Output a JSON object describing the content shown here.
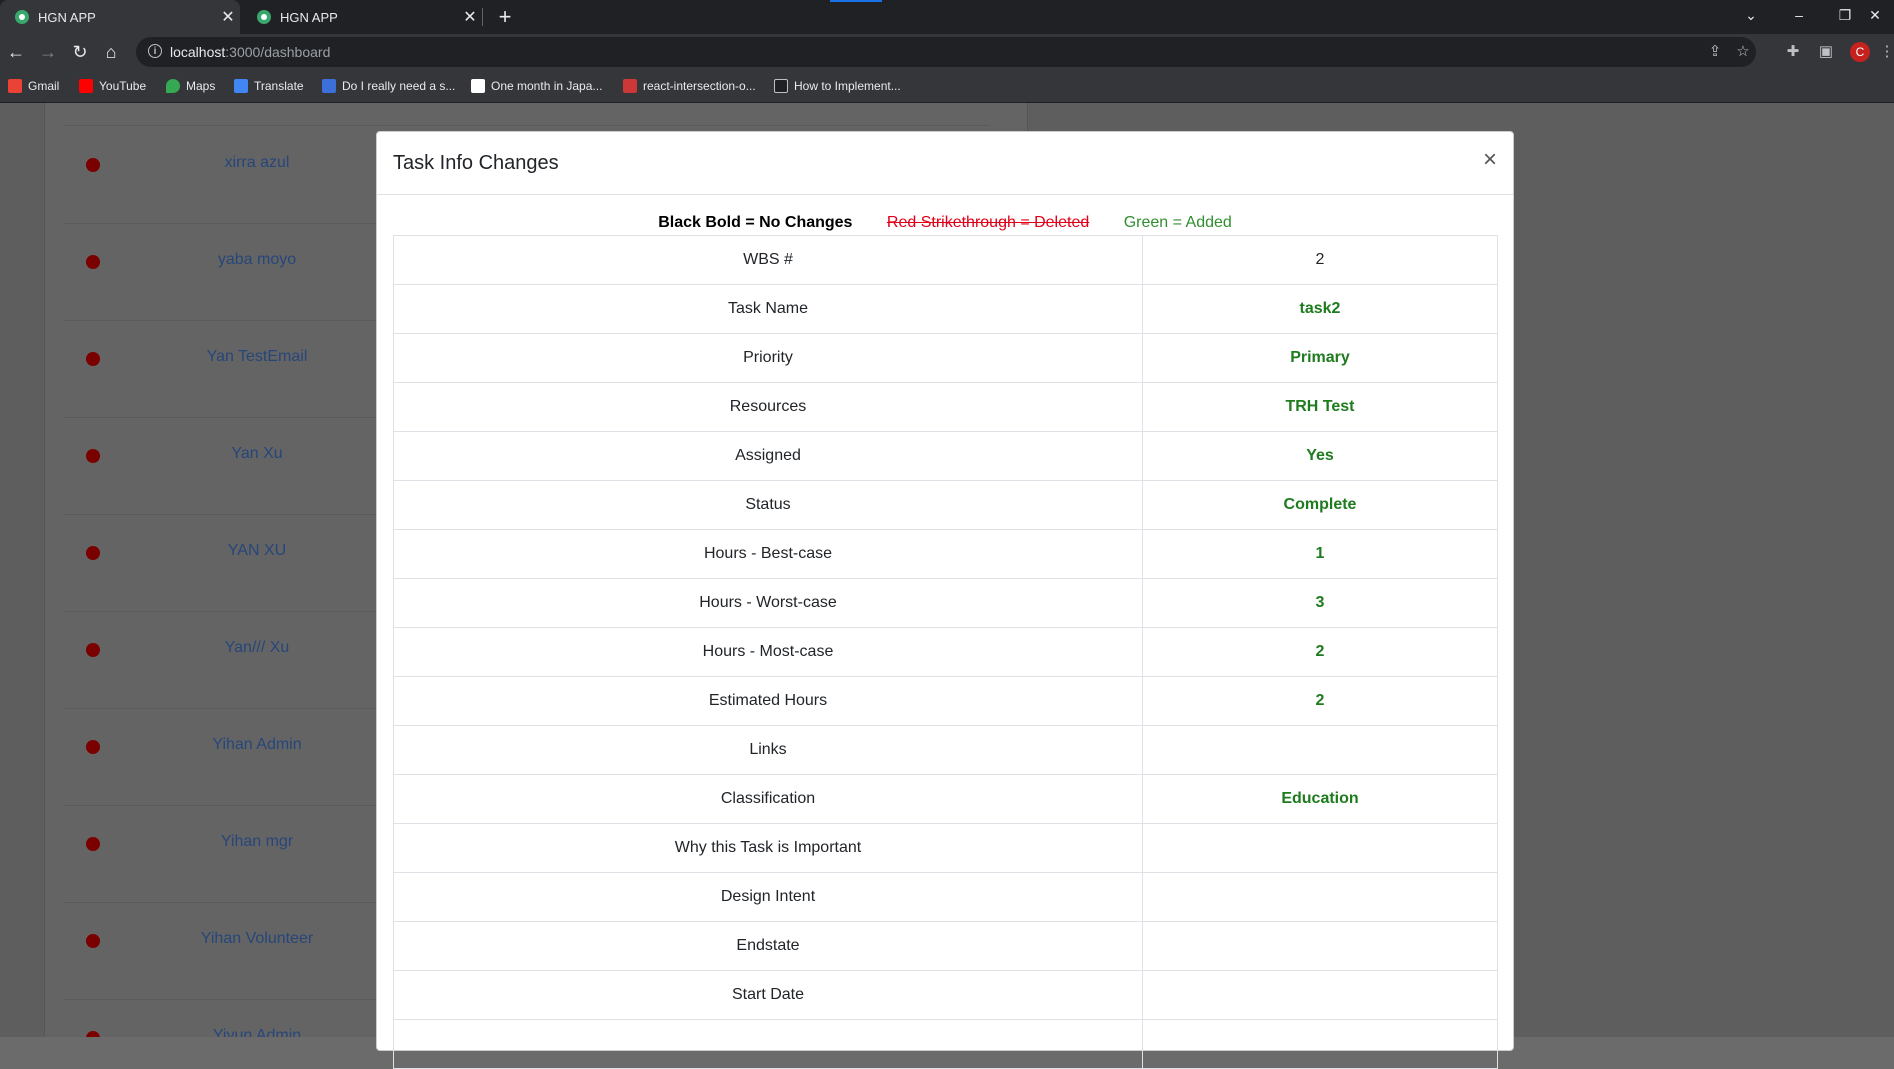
{
  "browser": {
    "tabs": [
      {
        "title": "HGN APP",
        "active": true
      },
      {
        "title": "HGN APP",
        "active": false
      }
    ],
    "url_host": "localhost",
    "url_path": ":3000/dashboard",
    "profile_initial": "C",
    "bookmarks": [
      {
        "label": "Gmail",
        "icon": "gmail-icon",
        "color": "#ea4335"
      },
      {
        "label": "YouTube",
        "icon": "youtube-icon",
        "color": "#ff0000"
      },
      {
        "label": "Maps",
        "icon": "maps-icon",
        "color": "#34a853"
      },
      {
        "label": "Translate",
        "icon": "translate-icon",
        "color": "#4285f4"
      },
      {
        "label": "Do I really need a s...",
        "icon": "site-icon",
        "color": "#3c6fd8"
      },
      {
        "label": "One month in Japa...",
        "icon": "page-icon",
        "color": "#ffffff"
      },
      {
        "label": "react-intersection-o...",
        "icon": "npm-icon",
        "color": "#cb3837"
      },
      {
        "label": "How to Implement...",
        "icon": "angular-icon",
        "color": "#202124"
      }
    ]
  },
  "background_list": {
    "users": [
      "xirra azul",
      "yaba moyo",
      "Yan TestEmail",
      "Yan Xu",
      "YAN XU",
      "Yan/// Xu",
      "Yihan Admin",
      "Yihan mgr",
      "Yihan Volunteer",
      "Yiyun Admin"
    ]
  },
  "modal": {
    "title": "Task Info Changes",
    "close_label": "×",
    "legend": {
      "no_change": "Black Bold = No Changes",
      "deleted": "Red Strikethrough = Deleted",
      "added": "Green = Added"
    },
    "rows": [
      {
        "label": "WBS #",
        "value": "2",
        "style": "plain"
      },
      {
        "label": "Task Name",
        "value": "task2",
        "style": "added"
      },
      {
        "label": "Priority",
        "value": "Primary",
        "style": "added"
      },
      {
        "label": "Resources",
        "value": "TRH Test",
        "style": "added"
      },
      {
        "label": "Assigned",
        "value": "Yes",
        "style": "added"
      },
      {
        "label": "Status",
        "value": "Complete",
        "style": "added"
      },
      {
        "label": "Hours - Best-case",
        "value": "1",
        "style": "added"
      },
      {
        "label": "Hours - Worst-case",
        "value": "3",
        "style": "added"
      },
      {
        "label": "Hours - Most-case",
        "value": "2",
        "style": "added"
      },
      {
        "label": "Estimated Hours",
        "value": "2",
        "style": "added"
      },
      {
        "label": "Links",
        "value": "",
        "style": "plain"
      },
      {
        "label": "Classification",
        "value": "Education",
        "style": "added"
      },
      {
        "label": "Why this Task is Important",
        "value": "",
        "style": "plain"
      },
      {
        "label": "Design Intent",
        "value": "",
        "style": "plain"
      },
      {
        "label": "Endstate",
        "value": "",
        "style": "plain"
      },
      {
        "label": "Start Date",
        "value": "",
        "style": "plain"
      },
      {
        "label": "",
        "value": "",
        "style": "plain"
      }
    ]
  }
}
